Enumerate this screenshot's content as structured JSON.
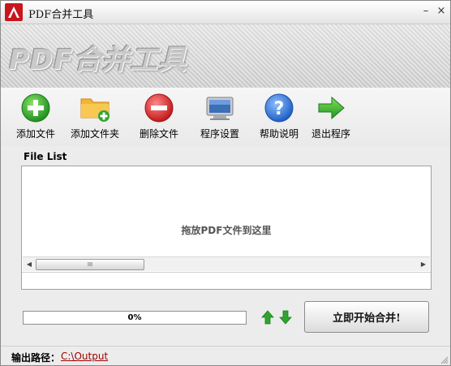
{
  "window": {
    "title": "PDF合并工具",
    "minimize_glyph": "–",
    "close_glyph": "×"
  },
  "banner": {
    "title": "PDF合并工具"
  },
  "toolbar": {
    "items": [
      {
        "label": "添加文件",
        "icon": "add-file-icon"
      },
      {
        "label": "添加文件夹",
        "icon": "add-folder-icon"
      },
      {
        "label": "删除文件",
        "icon": "delete-icon"
      },
      {
        "label": "程序设置",
        "icon": "settings-monitor-icon"
      },
      {
        "label": "帮助说明",
        "icon": "help-icon"
      },
      {
        "label": "退出程序",
        "icon": "exit-arrow-icon"
      }
    ]
  },
  "file_list": {
    "title": "File List",
    "drop_hint": "拖放PDF文件到这里",
    "scroll_thumb_glyph": "III"
  },
  "progress": {
    "value": 0,
    "text": "0%"
  },
  "actions": {
    "merge_label": "立即开始合并!"
  },
  "status": {
    "output_label": "输出路径：",
    "output_path": "C:\\Output"
  },
  "colors": {
    "accent_green": "#2fa42f",
    "delete_red": "#d42a2a",
    "help_blue": "#2a6fd6",
    "link_red": "#a00000"
  }
}
